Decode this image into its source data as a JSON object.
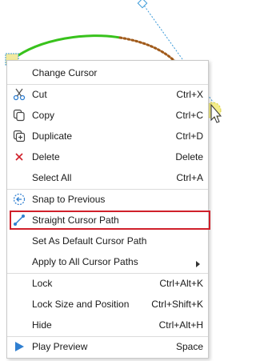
{
  "colors": {
    "curve_green": "#38c21c",
    "curve_brown": "#a05a1a",
    "guide_blue": "#3a9ad9",
    "highlight_red": "#d0202a",
    "icon_blue": "#2f7fd1"
  },
  "menu": {
    "change_cursor": {
      "label": "Change Cursor"
    },
    "cut": {
      "label": "Cut",
      "shortcut": "Ctrl+X",
      "icon": "scissors-icon"
    },
    "copy": {
      "label": "Copy",
      "shortcut": "Ctrl+C",
      "icon": "copy-icon"
    },
    "duplicate": {
      "label": "Duplicate",
      "shortcut": "Ctrl+D",
      "icon": "duplicate-icon"
    },
    "delete": {
      "label": "Delete",
      "shortcut": "Delete",
      "icon": "delete-x-icon"
    },
    "select_all": {
      "label": "Select All",
      "shortcut": "Ctrl+A"
    },
    "snap_to_previous": {
      "label": "Snap to Previous",
      "icon": "snap-icon"
    },
    "straight_cursor_path": {
      "label": "Straight Cursor Path",
      "icon": "straight-path-icon",
      "highlighted": true
    },
    "set_default_path": {
      "label": "Set As Default Cursor Path"
    },
    "apply_all_paths": {
      "label": "Apply to All Cursor Paths",
      "submenu": true
    },
    "lock": {
      "label": "Lock",
      "shortcut": "Ctrl+Alt+K"
    },
    "lock_size_position": {
      "label": "Lock Size and Position",
      "shortcut": "Ctrl+Shift+K"
    },
    "hide": {
      "label": "Hide",
      "shortcut": "Ctrl+Alt+H"
    },
    "play_preview": {
      "label": "Play Preview",
      "shortcut": "Space",
      "icon": "play-icon"
    }
  }
}
